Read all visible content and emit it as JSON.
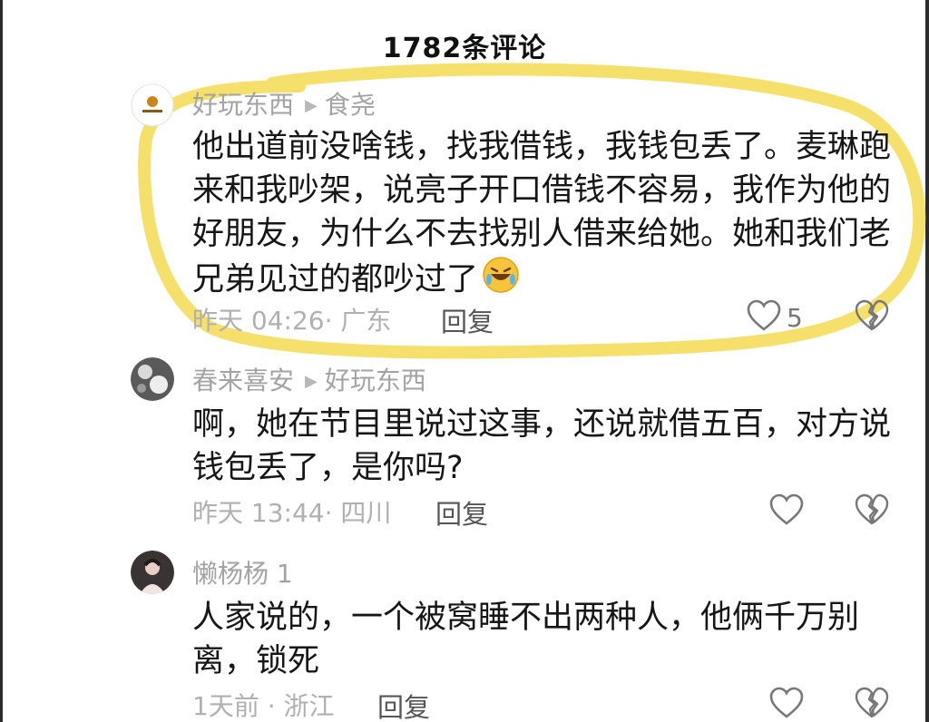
{
  "header": {
    "title": "1782条评论"
  },
  "comments": [
    {
      "author": "好玩东西",
      "reply_to": "食尧",
      "text": "他出道前没啥钱，找我借钱，我钱包丢了。麦琳跑来和我吵架，说亮子开口借钱不容易，我作为他的好朋友，为什么不去找别人借来给她。她和我们老兄弟见过的都吵过了",
      "emoji": "rolling-on-floor-laughing-emoji",
      "meta": "昨天 04:26· 广东",
      "reply_label": "回复",
      "like_count": "5"
    },
    {
      "author": "春来喜安",
      "reply_to": "好玩东西",
      "text": "啊，她在节目里说过这事，还说就借五百，对方说钱包丢了，是你吗?",
      "meta": "昨天 13:44· 四川",
      "reply_label": "回复",
      "like_count": ""
    },
    {
      "author": "懒杨杨 1",
      "text": "人家说的，一个被窝睡不出两种人，他俩千万别离，锁死",
      "meta": "1天前 · 浙江",
      "reply_label": "回复",
      "like_count": ""
    }
  ],
  "colors": {
    "highlight": "#f3dd5a",
    "text": "#161616",
    "muted": "#a3a3a3"
  }
}
